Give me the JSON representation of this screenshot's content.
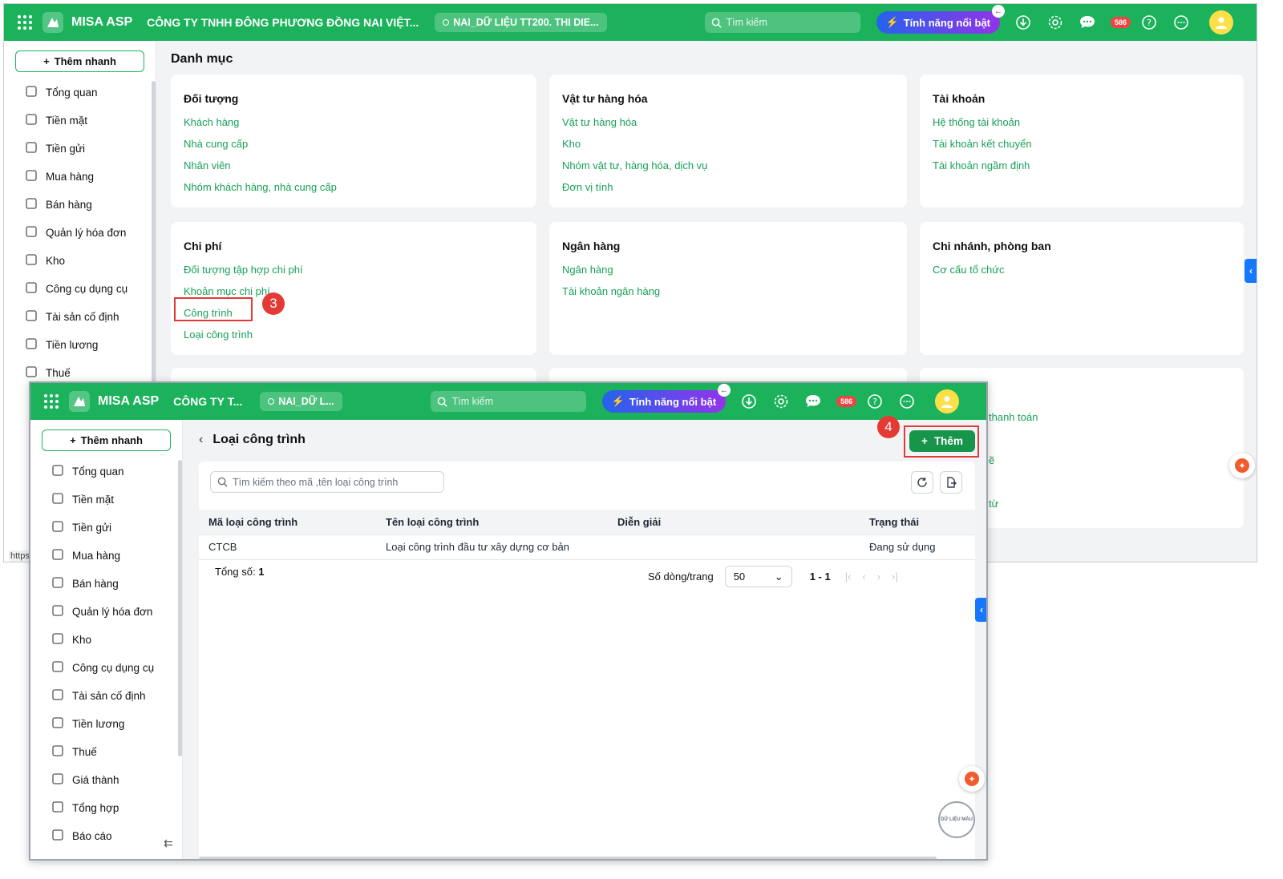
{
  "app": {
    "brand": "MISA ASP",
    "company_full": "CÔNG TY TNHH ĐÔNG PHƯƠNG ĐỒNG NAI VIỆT...",
    "company_short": "CÔNG TY T...",
    "database_full": "NAI_DỮ LIỆU TT200. THI DIE...",
    "database_short": "NAI_DỮ L...",
    "search_placeholder": "Tìm kiếm",
    "featured_label": "Tính năng nổi bật",
    "notification_count": "586",
    "url_fragment": "https",
    "accent_color": "#1cb25c"
  },
  "sidebar": {
    "quick_add": "Thêm nhanh",
    "items": [
      {
        "label": "Tổng quan",
        "icon": "dashboard-icon"
      },
      {
        "label": "Tiền mặt",
        "icon": "cash-icon"
      },
      {
        "label": "Tiền gửi",
        "icon": "bank-icon"
      },
      {
        "label": "Mua hàng",
        "icon": "shopping-bag-icon"
      },
      {
        "label": "Bán hàng",
        "icon": "cart-icon"
      },
      {
        "label": "Quản lý hóa đơn",
        "icon": "invoice-icon"
      },
      {
        "label": "Kho",
        "icon": "warehouse-icon"
      },
      {
        "label": "Công cụ dụng cụ",
        "icon": "tools-icon"
      },
      {
        "label": "Tài sản cố định",
        "icon": "car-icon"
      },
      {
        "label": "Tiền lương",
        "icon": "salary-icon"
      },
      {
        "label": "Thuế",
        "icon": "tax-icon"
      },
      {
        "label": "Giá thành",
        "icon": "price-icon"
      },
      {
        "label": "Tổng hợp",
        "icon": "summary-icon"
      },
      {
        "label": "Báo cáo",
        "icon": "report-icon"
      }
    ]
  },
  "catalog": {
    "title": "Danh mục",
    "cards": [
      {
        "title": "Đối tượng",
        "links": [
          "Khách hàng",
          "Nhà cung cấp",
          "Nhân viên",
          "Nhóm khách hàng, nhà cung cấp"
        ]
      },
      {
        "title": "Vật tư hàng hóa",
        "links": [
          "Vật tư hàng hóa",
          "Kho",
          "Nhóm vật tư, hàng hóa, dịch vụ",
          "Đơn vị tính"
        ]
      },
      {
        "title": "Tài khoản",
        "links": [
          "Hệ thống tài khoản",
          "Tài khoản kết chuyển",
          "Tài khoản ngầm định"
        ]
      },
      {
        "title": "Chi phí",
        "links": [
          "Đối tượng tập hợp chi phí",
          "Khoản mục chi phí",
          "Công trình",
          "Loại công trình"
        ]
      },
      {
        "title": "Ngân hàng",
        "links": [
          "Ngân hàng",
          "Tài khoản ngân hàng"
        ]
      },
      {
        "title": "Chi nhánh, phòng ban",
        "links": [
          "Cơ cấu tổ chức"
        ]
      }
    ],
    "partial_links": [
      "thanh toán",
      "ẽ",
      "từ"
    ]
  },
  "annotations": {
    "step3": "3",
    "step4": "4",
    "highlight_color": "#e53935"
  },
  "detail": {
    "title": "Loại công trình",
    "add_button": "Thêm",
    "search_placeholder": "Tìm kiếm theo mã ,tên loại công trình",
    "columns": [
      "Mã loại công trình",
      "Tên loại công trình",
      "Diễn giải",
      "Trạng thái"
    ],
    "rows": [
      {
        "code": "CTCB",
        "name": "Loại công trình đầu tư xây dựng cơ bản",
        "desc": "",
        "status": "Đang sử dụng"
      }
    ],
    "total_label": "Tổng số:",
    "total_value": "1",
    "rows_per_page_label": "Số dòng/trang",
    "rows_per_page": "50",
    "page_range": "1 - 1",
    "stamp_text": "DỮ LIỆU MẪU"
  }
}
